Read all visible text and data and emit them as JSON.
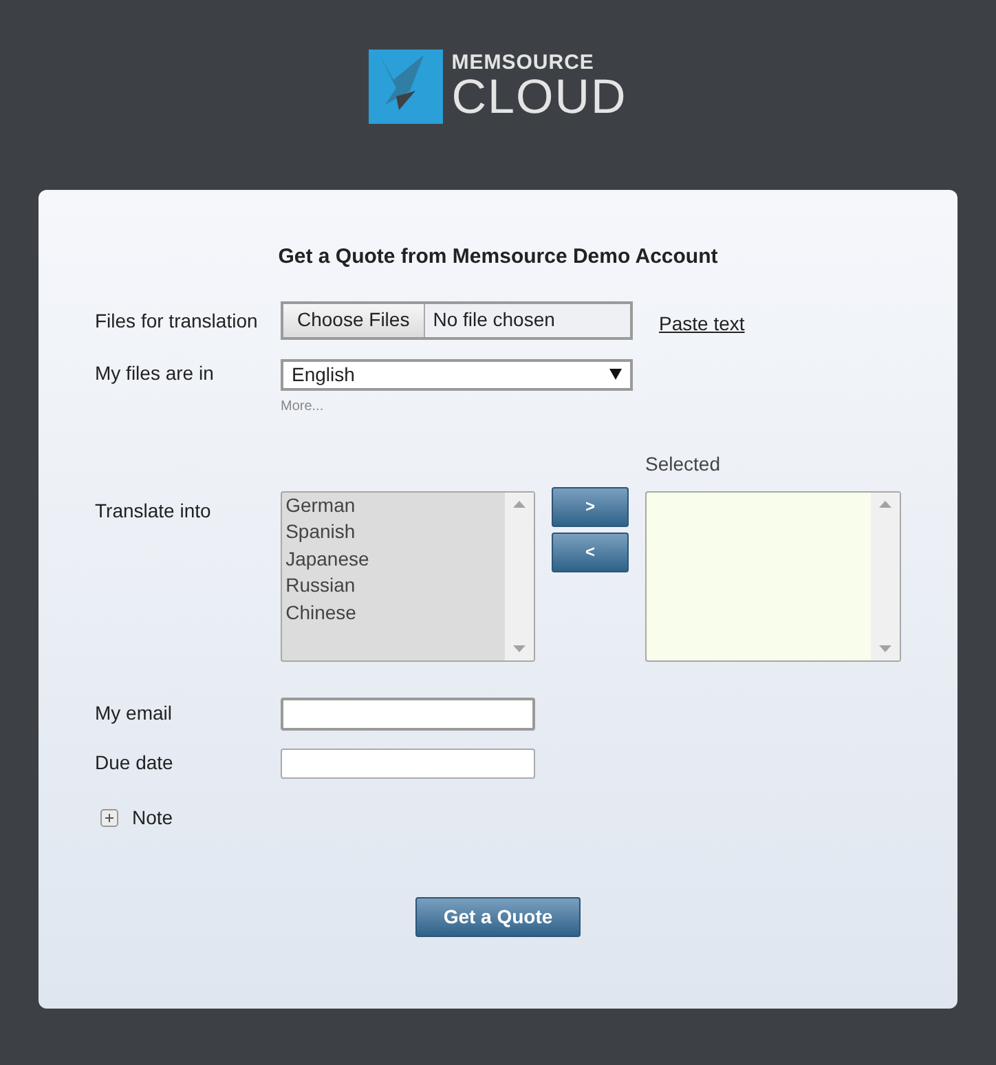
{
  "logo": {
    "line_1": "MEMSOURCE",
    "line_2": "CLOUD"
  },
  "form": {
    "title": "Get a Quote from Memsource Demo Account",
    "files": {
      "label": "Files for translation",
      "button": "Choose Files",
      "status": "No file chosen",
      "link": "Paste text"
    },
    "source": {
      "label": "My files are in",
      "value": "English",
      "more": "More..."
    },
    "target": {
      "label": "Translate into",
      "selected_label": "Selected",
      "available": [
        "German",
        "Spanish",
        "Japanese",
        "Russian",
        "Chinese"
      ],
      "add_button": ">",
      "remove_button": "<"
    },
    "email": {
      "label": "My email"
    },
    "due_date": {
      "label": "Due date"
    },
    "note": {
      "label": "Note",
      "expanded": false
    },
    "submit": "Get a Quote"
  }
}
